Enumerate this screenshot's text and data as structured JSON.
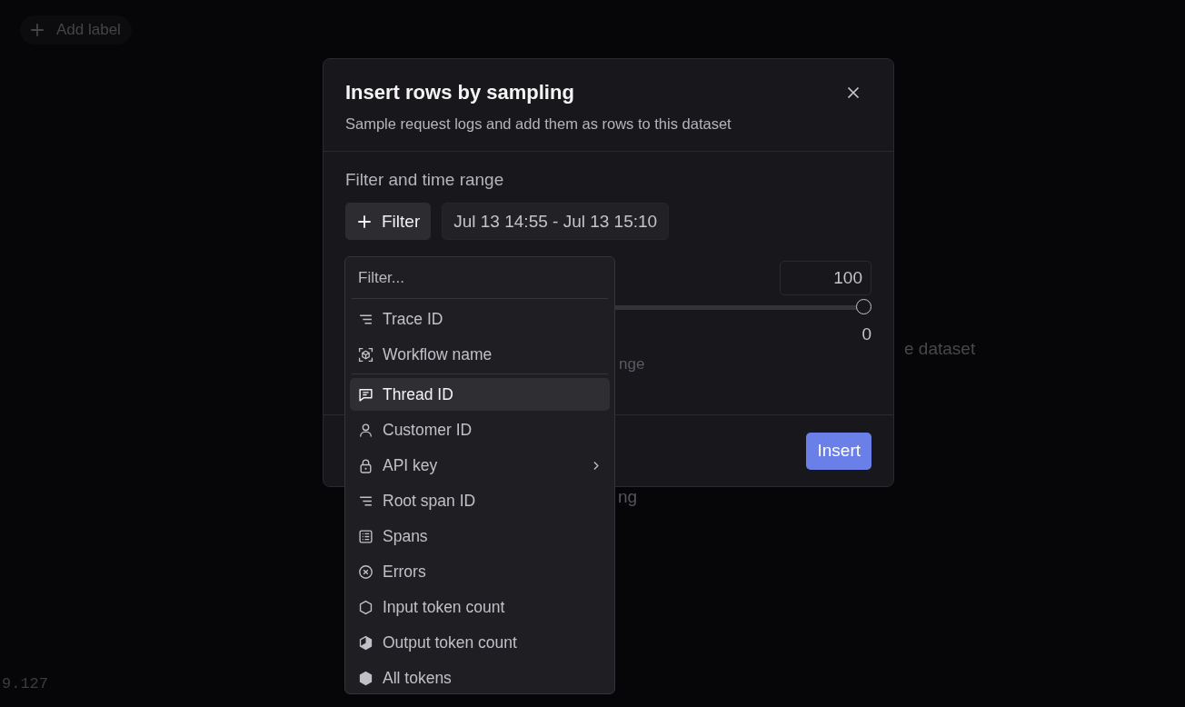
{
  "background": {
    "add_label_button": "Add label",
    "text_1": "e dataset",
    "text_2": "ng",
    "version": "9.127"
  },
  "dialog": {
    "title": "Insert rows by sampling",
    "subtitle": "Sample request logs and add them as rows to this dataset",
    "section_label": "Filter and time range",
    "filter_button": "Filter",
    "time_range": "Jul 13 14:55 - Jul 13 15:10",
    "count_field": {
      "value": "100"
    },
    "slider": {
      "level": 1
    },
    "count_reading": "0",
    "hint_text": "nge",
    "insert_button": "Insert"
  },
  "filter_menu": {
    "search": {
      "placeholder": "Filter..."
    },
    "groups": [
      {
        "items": [
          {
            "label": "Trace ID",
            "selected": false,
            "submenu": false
          },
          {
            "label": "Workflow name",
            "selected": false,
            "submenu": false
          }
        ]
      },
      {
        "items": [
          {
            "label": "Thread ID",
            "selected": true,
            "submenu": false
          },
          {
            "label": "Customer ID",
            "selected": false,
            "submenu": false
          },
          {
            "label": "API key",
            "selected": false,
            "submenu": true
          },
          {
            "label": "Root span ID",
            "selected": false,
            "submenu": false
          },
          {
            "label": "Spans",
            "selected": false,
            "submenu": false
          },
          {
            "label": "Errors",
            "selected": false,
            "submenu": false
          },
          {
            "label": "Input token count",
            "selected": false,
            "submenu": false
          },
          {
            "label": "Output token count",
            "selected": false,
            "submenu": false
          },
          {
            "label": "All tokens",
            "selected": false,
            "submenu": false
          }
        ]
      }
    ]
  }
}
